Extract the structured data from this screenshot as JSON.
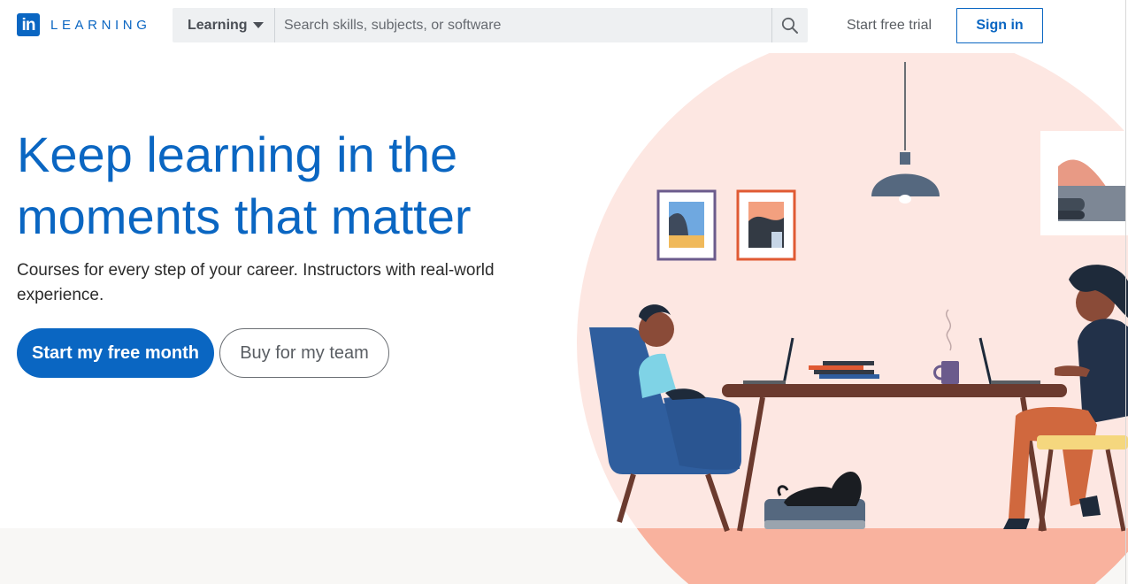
{
  "header": {
    "logo_mark": "in",
    "logo_word": "LEARNING",
    "search_type": "Learning",
    "search_placeholder": "Search skills, subjects, or software",
    "trial_link": "Start free trial",
    "signin_label": "Sign in"
  },
  "hero": {
    "title_line1": "Keep learning in the",
    "title_line2": "moments that matter",
    "subtitle": "Courses for every step of your career. Instructors with real-world experience.",
    "primary_cta": "Start my free month",
    "secondary_cta": "Buy for my team"
  },
  "icons": {
    "search": "search-icon",
    "caret": "chevron-down-icon"
  },
  "colors": {
    "brand": "#0a66c2",
    "circle_bg": "#fde7e2",
    "floor": "#f9b29e",
    "chair": "#2f5e9e",
    "table": "#6b3a2e"
  }
}
